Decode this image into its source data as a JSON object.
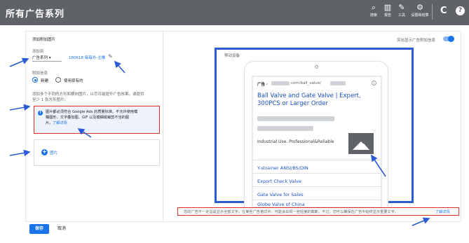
{
  "topbar": {
    "title": "所有广告系列",
    "icons": [
      {
        "name": "search-icon",
        "label": "搜索",
        "glyph": "⌕"
      },
      {
        "name": "reports-icon",
        "label": "报告",
        "glyph": "▥"
      },
      {
        "name": "tools-icon",
        "label": "工具",
        "glyph": "✎"
      },
      {
        "name": "settings-icon",
        "label": "设置和结算",
        "glyph": "⚙"
      }
    ],
    "refresh_glyph": "C",
    "help_glyph": "?"
  },
  "form": {
    "section_title": "添加附加图片",
    "add_to_label": "添加到",
    "add_to_value": "广告系列 ▾",
    "campaign_link": "180618 每每外-主推",
    "extension_label": "附加信息",
    "radio_new": "新建",
    "radio_existing": "使用现有的",
    "help_line1": "添加多个不同的方形和横向图片，以尽可能提升广告效果。请提供",
    "help_line2": "至少 1 张方形图片。",
    "info_line1": "图片都必须符合 Google Ads 的质量标准。不允许使用模",
    "info_line2": "糊图形、文字叠加图、GIF 以及模糊或裁剪不当的图",
    "info_line3": "片。",
    "info_learn_more": "了解详情",
    "image_button": "图片"
  },
  "preview": {
    "toggle_label": "突出显示广告附加信息",
    "device_label": "移动设备",
    "ad_label": "广告 ·",
    "ad_url": "com/ball_valve/",
    "ad_title": "Ball Valve and Gate Valve | Expert, 300PCS or Larger Order",
    "ad_desc": "Industrial Use. Professional&Reliable",
    "sitelinks": [
      "Y-strainer ANSI/BS/DIN",
      "Export Check Valve",
      "Gate Valve for Sales",
      "Globe Valve of China"
    ],
    "ad_info_glyph": "i"
  },
  "notice": {
    "text": "您的广告不一定总是显示全部文字。在某些广告格式中，可能会出现一些轻度的截断。不过，您可以确保在广告中始终显示重要文字。",
    "link": "了解详情"
  },
  "actions": {
    "save": "保存",
    "cancel": "取消"
  },
  "colors": {
    "topbar": "#5f6368",
    "accent": "#1a73e8",
    "highlight_border": "#d93025",
    "preview_border": "#2b5cd6"
  }
}
